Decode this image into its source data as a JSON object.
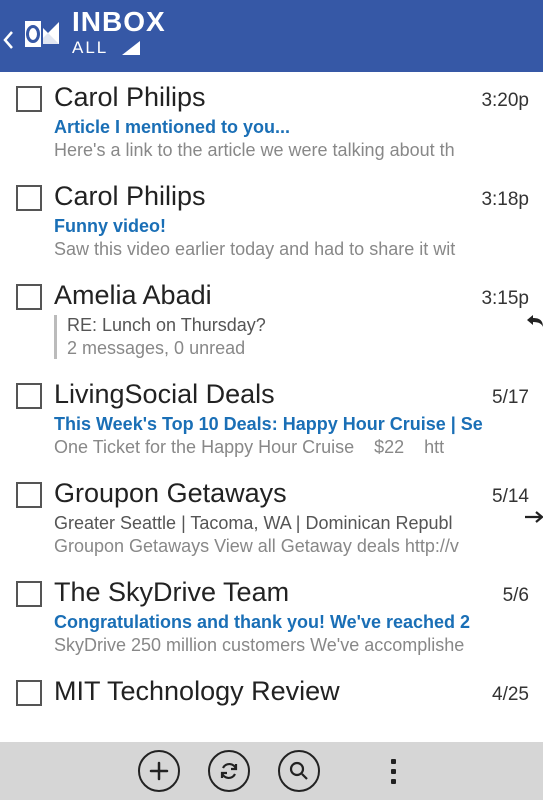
{
  "header": {
    "title": "INBOX",
    "filter": "ALL"
  },
  "messages": [
    {
      "sender": "Carol Philips",
      "time": "3:20p",
      "subject": "Article I mentioned to you...",
      "preview": "Here's a link to the article we were talking about th",
      "unread": true
    },
    {
      "sender": "Carol Philips",
      "time": "3:18p",
      "subject": "Funny video!",
      "preview": "Saw this video earlier today and had to share it wit",
      "unread": true
    },
    {
      "sender": "Amelia Abadi",
      "time": "3:15p",
      "thread_subject": "RE: Lunch on Thursday?",
      "thread_info": "2 messages, 0 unread",
      "corner": "reply"
    },
    {
      "sender": "LivingSocial Deals",
      "time": "5/17",
      "subject": "This Week's Top 10 Deals: Happy Hour Cruise | Se",
      "preview": "One Ticket for the Happy Hour Cruise    $22    htt",
      "unread": true
    },
    {
      "sender": "Groupon Getaways",
      "time": "5/14",
      "subject": "Greater Seattle | Tacoma, WA | Dominican Republ",
      "preview": "Groupon Getaways View all Getaway deals http://v",
      "unread": false,
      "corner": "forward"
    },
    {
      "sender": "The SkyDrive Team",
      "time": "5/6",
      "subject": "Congratulations and thank you! We've reached 2",
      "preview": "SkyDrive 250 million customers We've accomplishe",
      "unread": true
    },
    {
      "sender": "MIT Technology Review",
      "time": "4/25"
    }
  ],
  "appbar": {
    "new": "new",
    "sync": "sync",
    "search": "search",
    "more": "more"
  }
}
